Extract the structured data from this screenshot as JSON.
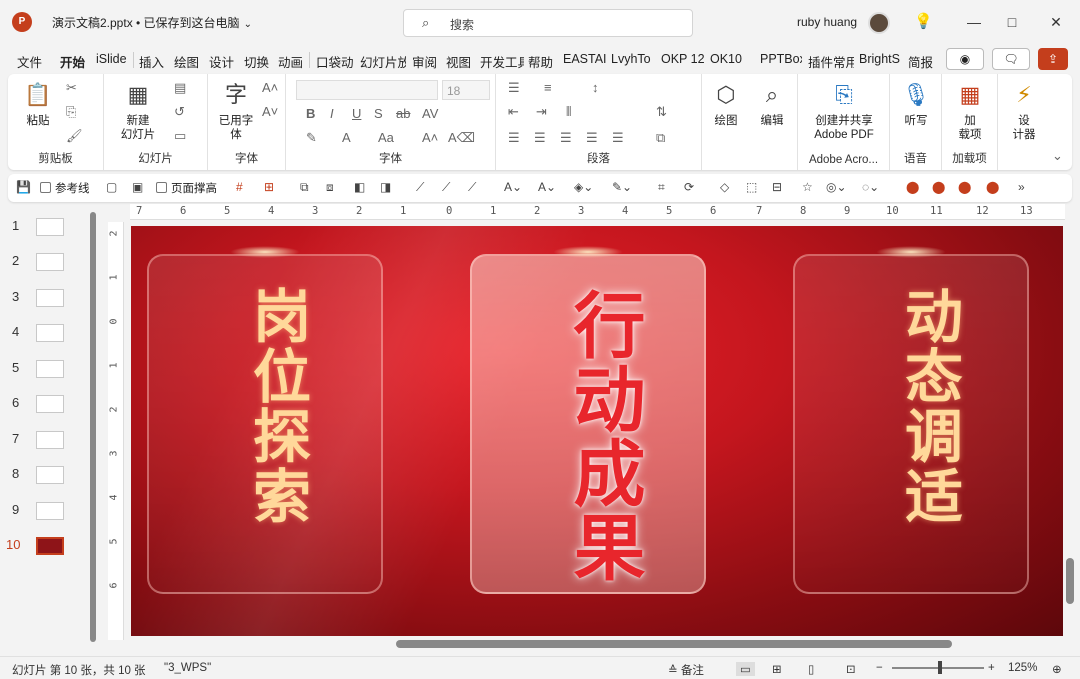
{
  "window": {
    "title": "演示文稿2.pptx • 已保存到这台电脑",
    "app_logo": "P",
    "search_placeholder": "搜索",
    "user_name": "ruby huang",
    "controls": [
      "—",
      "□",
      "✕"
    ]
  },
  "tabs": [
    "文件",
    "开始",
    "iSlide",
    "插入",
    "绘图",
    "设计",
    "切换",
    "动画",
    "口袋动",
    "幻灯片放",
    "审阅",
    "视图",
    "开发工具",
    "帮助",
    "EASTAI",
    "LvyhTo",
    "OKP 12",
    "OK10",
    "PPTBox",
    "插件常用",
    "BrightS",
    "简报"
  ],
  "active_tab": "开始",
  "ribbon": {
    "groups": [
      {
        "name": "剪贴板",
        "big": [
          "粘贴"
        ]
      },
      {
        "name": "幻灯片",
        "big": [
          "新建\n幻灯片"
        ]
      },
      {
        "name": "字体",
        "big": [
          "已用字\n体"
        ]
      },
      {
        "name": "字体",
        "big": []
      },
      {
        "name": "段落",
        "big": []
      },
      {
        "name": "",
        "big": [
          "绘图",
          "编辑"
        ]
      },
      {
        "name": "Adobe Acro...",
        "big": [
          "创建并共享\nAdobe PDF"
        ]
      },
      {
        "name": "语音",
        "big": [
          "听写"
        ]
      },
      {
        "name": "加载项",
        "big": [
          "加\n载项"
        ]
      },
      {
        "name": "",
        "big": [
          "设\n计器"
        ]
      }
    ],
    "font_size": "18"
  },
  "quickbar": {
    "guide_label": "参考线",
    "fill_label": "页面撑高"
  },
  "slides": {
    "numbers": [
      "1",
      "2",
      "3",
      "4",
      "5",
      "6",
      "7",
      "8",
      "9",
      "10"
    ],
    "current": "10"
  },
  "ruler": {
    "h": [
      "7",
      "6",
      "5",
      "4",
      "3",
      "2",
      "1",
      "0",
      "1",
      "2",
      "3",
      "4",
      "5",
      "6",
      "7",
      "8",
      "9",
      "10",
      "11",
      "12",
      "13"
    ],
    "v": [
      "2",
      "1",
      "0",
      "1",
      "2",
      "3",
      "4",
      "5",
      "6"
    ]
  },
  "slide": {
    "card1_text": "岗位探索",
    "card2_text": "行动成果",
    "card3_text": "动态调适"
  },
  "status": {
    "slide_info": "幻灯片 第 10 张，共 10 张",
    "theme": "\"3_WPS\"",
    "notes_label": "备注",
    "zoom": "125%"
  },
  "colors": {
    "accent": "#c43e1c",
    "slide_bg": "#c4161e",
    "gold_text": "#ffd89a"
  }
}
